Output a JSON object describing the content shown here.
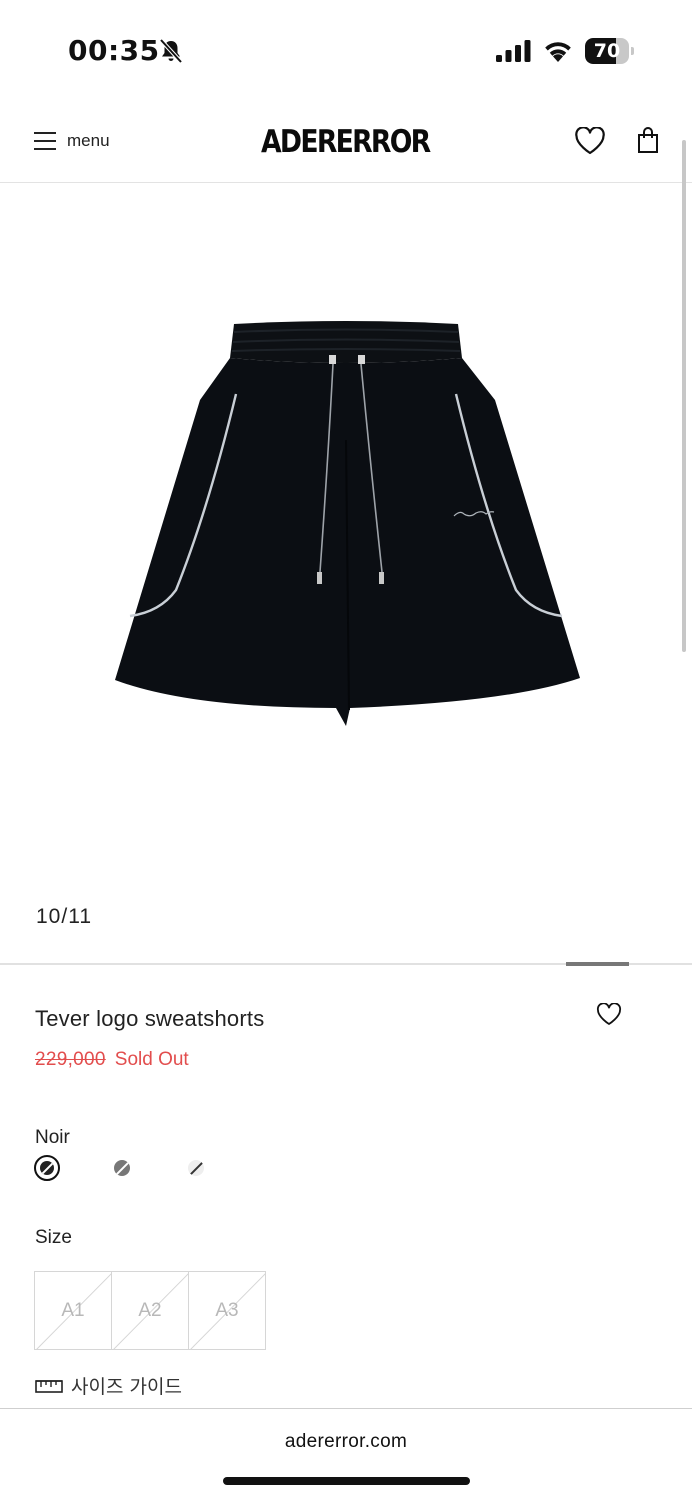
{
  "status_bar": {
    "time": "00:35",
    "battery_level": "70",
    "battery_fraction": 0.7,
    "icons": [
      "bell-slash-icon",
      "cellular-signal-icon",
      "wifi-icon",
      "battery-icon"
    ]
  },
  "header": {
    "menu_label": "menu",
    "brand": "ADERERROR",
    "icons": [
      "hamburger-icon",
      "heart-icon",
      "shopping-bag-icon"
    ]
  },
  "gallery": {
    "counter": "10/11",
    "image_subject": "black-sweatshorts-image"
  },
  "product": {
    "name": "Tever logo sweatshorts",
    "original_price": "229,000",
    "status": "Sold Out",
    "price_color": "#e24d4d"
  },
  "options": {
    "color_label": "Noir",
    "colors": [
      {
        "name": "noir",
        "hex": "#222222",
        "selected": true
      },
      {
        "name": "gray",
        "hex": "#777777",
        "selected": false
      },
      {
        "name": "white",
        "hex": "#eeeeee",
        "selected": false
      }
    ],
    "size_label": "Size",
    "sizes": [
      "A1",
      "A2",
      "A3"
    ],
    "size_guide_label": "사이즈 가이드"
  },
  "browser": {
    "url": "adererror.com"
  }
}
